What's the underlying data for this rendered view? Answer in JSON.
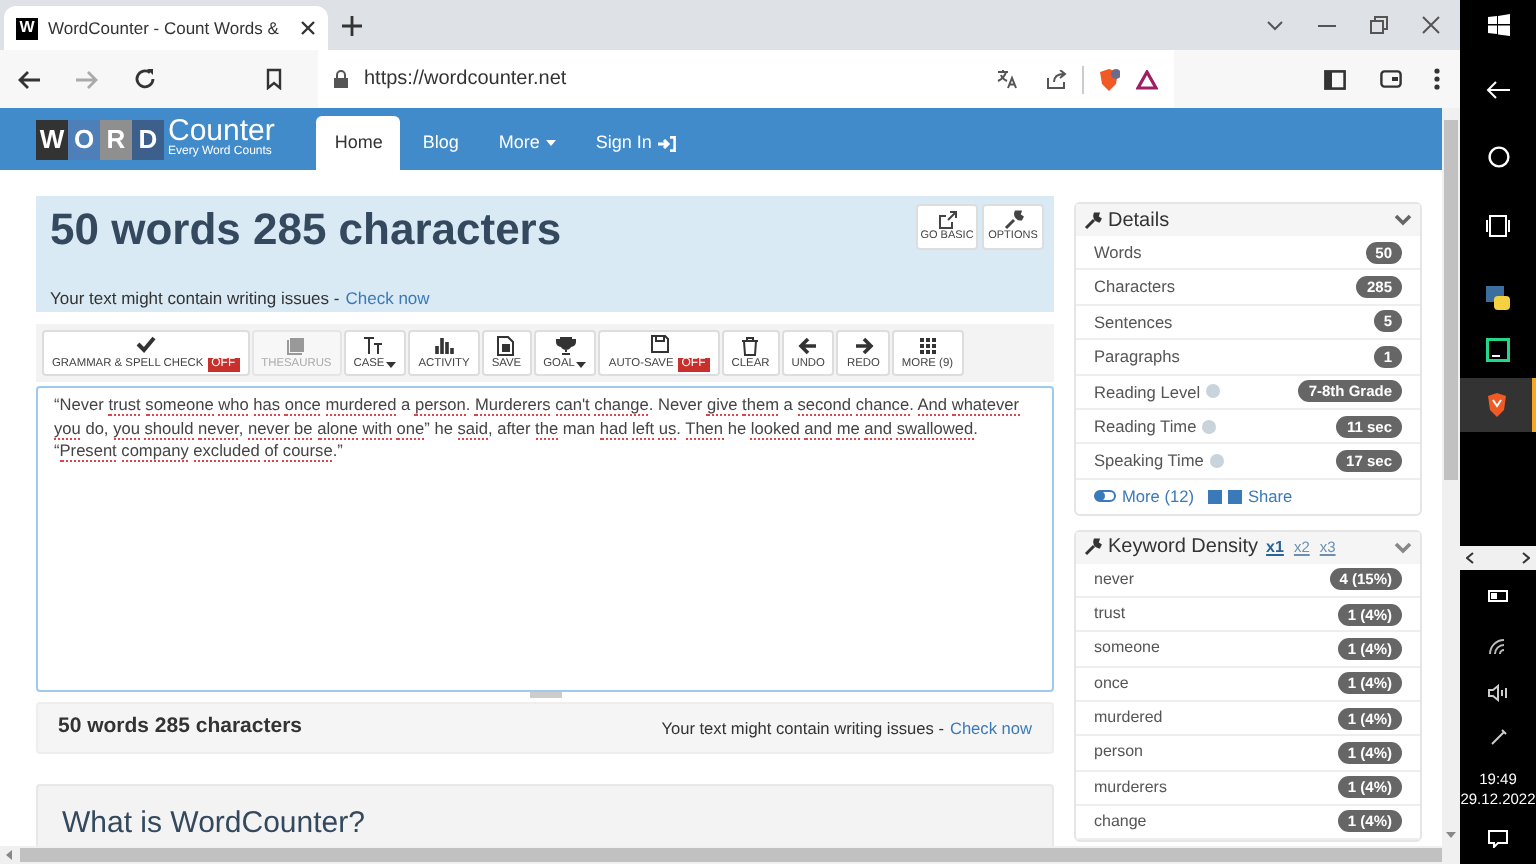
{
  "browser": {
    "tab": {
      "icon_text": "W",
      "title": "WordCounter - Count Words &"
    },
    "url": "https://wordcounter.net"
  },
  "site_nav": {
    "logo": {
      "letters": [
        {
          "text": "W",
          "color": "#333333"
        },
        {
          "text": "O",
          "color": "#4e7fb8"
        },
        {
          "text": "R",
          "color": "#8f8f8f"
        },
        {
          "text": "D",
          "color": "#3d5f8c"
        }
      ],
      "name": "Counter",
      "tagline": "Every Word Counts"
    },
    "links": [
      {
        "label": "Home",
        "selected": true,
        "kind": "plain"
      },
      {
        "label": "Blog",
        "selected": false,
        "kind": "plain"
      },
      {
        "label": "More",
        "selected": false,
        "kind": "dropdown"
      },
      {
        "label": "Sign In",
        "selected": false,
        "kind": "signin"
      }
    ]
  },
  "summary": {
    "title": "50 words 285 characters",
    "notice": "Your text might contain writing issues -",
    "link": "Check now",
    "buttons": [
      {
        "label": "GO BASIC",
        "kind": "external"
      },
      {
        "label": "OPTIONS",
        "kind": "wrench"
      }
    ]
  },
  "toolbar": [
    {
      "label": "GRAMMAR & SPELL CHECK",
      "kind": "check",
      "badge": "OFF",
      "disabled": false,
      "dropdown": false
    },
    {
      "label": "THESAURUS",
      "kind": "book",
      "disabled": true,
      "dropdown": false
    },
    {
      "label": "CASE",
      "kind": "case",
      "disabled": false,
      "dropdown": true
    },
    {
      "label": "ACTIVITY",
      "kind": "bars",
      "disabled": false,
      "dropdown": false
    },
    {
      "label": "SAVE",
      "kind": "file",
      "disabled": false,
      "dropdown": false
    },
    {
      "label": "GOAL",
      "kind": "trophy",
      "disabled": false,
      "dropdown": true
    },
    {
      "label": "AUTO-SAVE",
      "kind": "floppy",
      "badge": "OFF",
      "disabled": false,
      "dropdown": false
    },
    {
      "label": "CLEAR",
      "kind": "trash",
      "disabled": false,
      "dropdown": false
    },
    {
      "label": "UNDO",
      "kind": "left",
      "disabled": false,
      "dropdown": false
    },
    {
      "label": "REDO",
      "kind": "right",
      "disabled": false,
      "dropdown": false
    },
    {
      "label": "MORE (9)",
      "kind": "grid",
      "disabled": false,
      "dropdown": false
    }
  ],
  "editor": {
    "words": [
      {
        "text": "“Never",
        "flagged": false
      },
      {
        "text": "trust",
        "flagged": true
      },
      {
        "text": "someone",
        "flagged": true
      },
      {
        "text": "who",
        "flagged": true
      },
      {
        "text": "has",
        "flagged": true
      },
      {
        "text": "once",
        "flagged": true
      },
      {
        "text": "murdered",
        "flagged": true
      },
      {
        "text": "a",
        "flagged": false
      },
      {
        "text": "person",
        "flagged": true,
        "after": "."
      },
      {
        "text": "Murderers",
        "flagged": true
      },
      {
        "text": "can't",
        "flagged": true
      },
      {
        "text": "change",
        "flagged": true,
        "after": "."
      },
      {
        "text": "Never",
        "flagged": false
      },
      {
        "text": "give",
        "flagged": true
      },
      {
        "text": "them",
        "flagged": true
      },
      {
        "text": "a",
        "flagged": false
      },
      {
        "text": "second",
        "flagged": true
      },
      {
        "text": "chance",
        "flagged": true,
        "after": "."
      },
      {
        "text": "And",
        "flagged": true
      },
      {
        "text": "whatever",
        "flagged": true
      },
      {
        "text": "you",
        "flagged": true
      },
      {
        "text": "do,",
        "flagged": false
      },
      {
        "text": "you",
        "flagged": true
      },
      {
        "text": "should",
        "flagged": true
      },
      {
        "text": "never",
        "flagged": true,
        "after": ","
      },
      {
        "text": "never",
        "flagged": true
      },
      {
        "text": "be",
        "flagged": true
      },
      {
        "text": "alone",
        "flagged": true
      },
      {
        "text": "with",
        "flagged": true
      },
      {
        "text": "one",
        "flagged": true,
        "after": "”"
      },
      {
        "text": "he",
        "flagged": false
      },
      {
        "text": "said",
        "flagged": true,
        "after": ","
      },
      {
        "text": "after",
        "flagged": false
      },
      {
        "text": "the",
        "flagged": true
      },
      {
        "text": "man",
        "flagged": false
      },
      {
        "text": "had",
        "flagged": true
      },
      {
        "text": "left",
        "flagged": true
      },
      {
        "text": "us",
        "flagged": true,
        "after": "."
      },
      {
        "text": "Then",
        "flagged": true
      },
      {
        "text": "he",
        "flagged": false
      },
      {
        "text": "looked",
        "flagged": true
      },
      {
        "text": "and",
        "flagged": true
      },
      {
        "text": "me",
        "flagged": true
      },
      {
        "text": "and",
        "flagged": true
      },
      {
        "text": "swallowed",
        "flagged": true,
        "after": "."
      },
      {
        "text": "Present",
        "flagged": true,
        "before": "“"
      },
      {
        "text": "company",
        "flagged": true
      },
      {
        "text": "excluded",
        "flagged": true
      },
      {
        "text": "of",
        "flagged": true
      },
      {
        "text": "course",
        "flagged": true,
        "after": ".”"
      }
    ]
  },
  "stats_bar": {
    "title": "50 words 285 characters",
    "notice": "Your text might contain writing issues -",
    "link": "Check now"
  },
  "what_is": {
    "title": "What is WordCounter?"
  },
  "details": {
    "title": "Details",
    "rows": [
      {
        "label": "Words",
        "value": "50",
        "help": false
      },
      {
        "label": "Characters",
        "value": "285",
        "help": false
      },
      {
        "label": "Sentences",
        "value": "5",
        "help": false
      },
      {
        "label": "Paragraphs",
        "value": "1",
        "help": false
      },
      {
        "label": "Reading Level",
        "value": "7-8th Grade",
        "help": true
      },
      {
        "label": "Reading Time",
        "value": "11 sec",
        "help": true
      },
      {
        "label": "Speaking Time",
        "value": "17 sec",
        "help": true
      }
    ],
    "more": "More (12)",
    "share": "Share"
  },
  "keyword_density": {
    "title": "Keyword Density",
    "tabs": [
      {
        "label": "x1",
        "selected": true
      },
      {
        "label": "x2",
        "selected": false
      },
      {
        "label": "x3",
        "selected": false
      }
    ],
    "rows": [
      {
        "word": "never",
        "value": "4 (15%)"
      },
      {
        "word": "trust",
        "value": "1 (4%)"
      },
      {
        "word": "someone",
        "value": "1 (4%)"
      },
      {
        "word": "once",
        "value": "1 (4%)"
      },
      {
        "word": "murdered",
        "value": "1 (4%)"
      },
      {
        "word": "person",
        "value": "1 (4%)"
      },
      {
        "word": "murderers",
        "value": "1 (4%)"
      },
      {
        "word": "change",
        "value": "1 (4%)"
      }
    ]
  },
  "taskbar": {
    "time": "19:49",
    "date": "29.12.2022"
  }
}
